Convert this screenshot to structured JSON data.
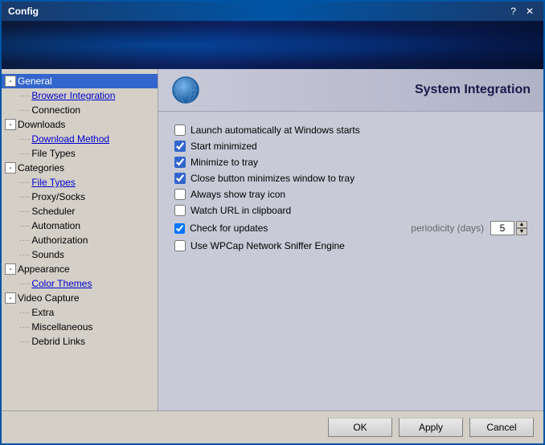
{
  "window": {
    "title": "Config",
    "help_btn": "?",
    "close_btn": "✕"
  },
  "sidebar": {
    "items": [
      {
        "id": "general",
        "label": "General",
        "indent": 0,
        "expander": "-",
        "selected": true,
        "link": false
      },
      {
        "id": "browser-integration",
        "label": "Browser Integration",
        "indent": 1,
        "expander": null,
        "selected": false,
        "link": true
      },
      {
        "id": "connection",
        "label": "Connection",
        "indent": 1,
        "expander": null,
        "selected": false,
        "link": false
      },
      {
        "id": "downloads",
        "label": "Downloads",
        "indent": 0,
        "expander": "-",
        "selected": false,
        "link": false
      },
      {
        "id": "download-method",
        "label": "Download Method",
        "indent": 1,
        "expander": null,
        "selected": false,
        "link": true
      },
      {
        "id": "file-types",
        "label": "File Types",
        "indent": 1,
        "expander": null,
        "selected": false,
        "link": false
      },
      {
        "id": "categories",
        "label": "Categories",
        "indent": 0,
        "expander": "-",
        "selected": false,
        "link": false
      },
      {
        "id": "cat-file-types",
        "label": "File Types",
        "indent": 1,
        "expander": null,
        "selected": false,
        "link": true
      },
      {
        "id": "proxy-socks",
        "label": "Proxy/Socks",
        "indent": 1,
        "expander": null,
        "selected": false,
        "link": false
      },
      {
        "id": "scheduler",
        "label": "Scheduler",
        "indent": 1,
        "expander": null,
        "selected": false,
        "link": false
      },
      {
        "id": "automation",
        "label": "Automation",
        "indent": 1,
        "expander": null,
        "selected": false,
        "link": false
      },
      {
        "id": "authorization",
        "label": "Authorization",
        "indent": 1,
        "expander": null,
        "selected": false,
        "link": false
      },
      {
        "id": "sounds",
        "label": "Sounds",
        "indent": 1,
        "expander": null,
        "selected": false,
        "link": false
      },
      {
        "id": "appearance",
        "label": "Appearance",
        "indent": 0,
        "expander": "-",
        "selected": false,
        "link": false
      },
      {
        "id": "color-themes",
        "label": "Color Themes",
        "indent": 1,
        "expander": null,
        "selected": false,
        "link": true
      },
      {
        "id": "video-capture",
        "label": "Video Capture",
        "indent": 0,
        "expander": "-",
        "selected": false,
        "link": false
      },
      {
        "id": "extra",
        "label": "Extra",
        "indent": 1,
        "expander": null,
        "selected": false,
        "link": false
      },
      {
        "id": "miscellaneous",
        "label": "Miscellaneous",
        "indent": 1,
        "expander": null,
        "selected": false,
        "link": false
      },
      {
        "id": "debrid-links",
        "label": "Debrid Links",
        "indent": 1,
        "expander": null,
        "selected": false,
        "link": false
      }
    ]
  },
  "panel": {
    "title": "System Integration",
    "options": [
      {
        "id": "launch-auto",
        "label": "Launch automatically at Windows starts",
        "checked": false
      },
      {
        "id": "start-minimized",
        "label": "Start minimized",
        "checked": true
      },
      {
        "id": "minimize-tray",
        "label": "Minimize to tray",
        "checked": true
      },
      {
        "id": "close-minimizes",
        "label": "Close button minimizes window to tray",
        "checked": true
      },
      {
        "id": "always-tray",
        "label": "Always show tray icon",
        "checked": false
      },
      {
        "id": "watch-url",
        "label": "Watch URL in clipboard",
        "checked": false
      },
      {
        "id": "check-updates",
        "label": "Check for updates",
        "checked": true,
        "has_extra": true,
        "extra_label": "periodicity (days)",
        "extra_value": "5"
      },
      {
        "id": "use-wpcap",
        "label": "Use WPCap Network Sniffer Engine",
        "checked": false
      }
    ]
  },
  "buttons": {
    "ok": "OK",
    "apply": "Apply",
    "cancel": "Cancel"
  }
}
